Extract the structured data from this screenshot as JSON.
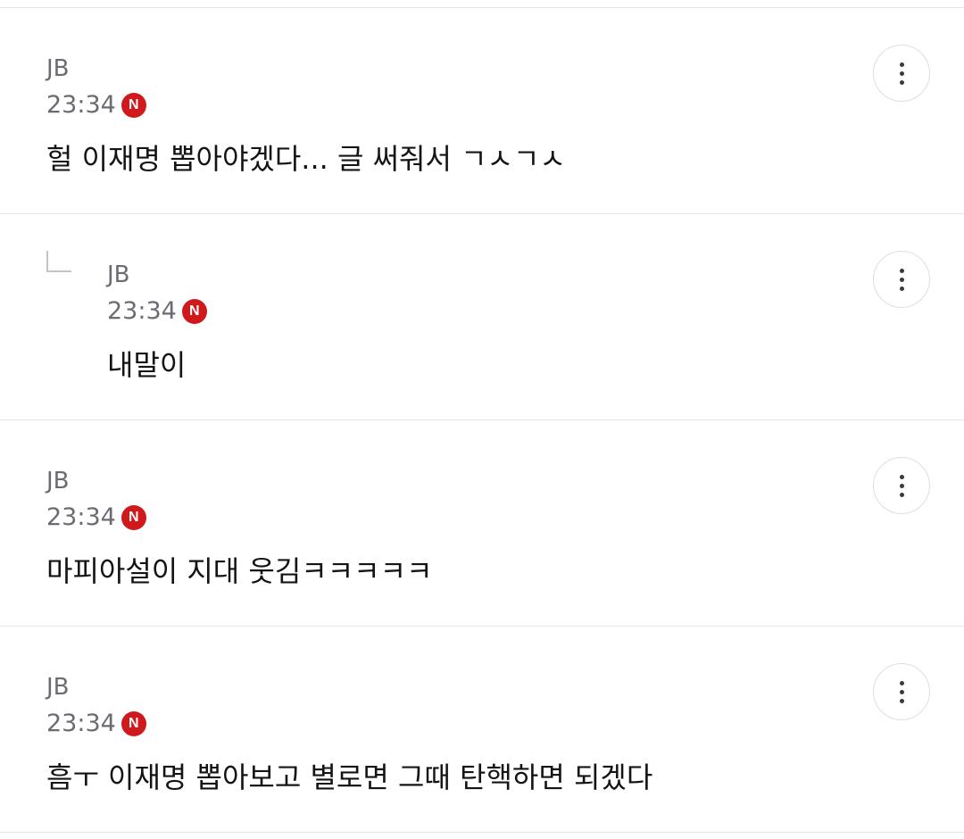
{
  "comments": [
    {
      "author": "JB",
      "time": "23:34",
      "badge": "N",
      "text": "헐 이재명 뽑아야겠다... 글 써줘서 ㄱㅅㄱㅅ",
      "is_reply": false
    },
    {
      "author": "JB",
      "time": "23:34",
      "badge": "N",
      "text": "내말이",
      "is_reply": true
    },
    {
      "author": "JB",
      "time": "23:34",
      "badge": "N",
      "text": "마피아설이 지대 웃김ㅋㅋㅋㅋㅋ",
      "is_reply": false
    },
    {
      "author": "JB",
      "time": "23:34",
      "badge": "N",
      "text": "흠ㅜ 이재명 뽑아보고 별로면 그때 탄핵하면 되겠다",
      "is_reply": false
    }
  ],
  "colors": {
    "badge": "#d0191c",
    "meta_text": "#6b6b73",
    "body_text": "#141414",
    "divider": "#e6e6e6"
  },
  "icons": {
    "more": "more-vertical-icon",
    "reply": "reply-arrow-icon"
  }
}
